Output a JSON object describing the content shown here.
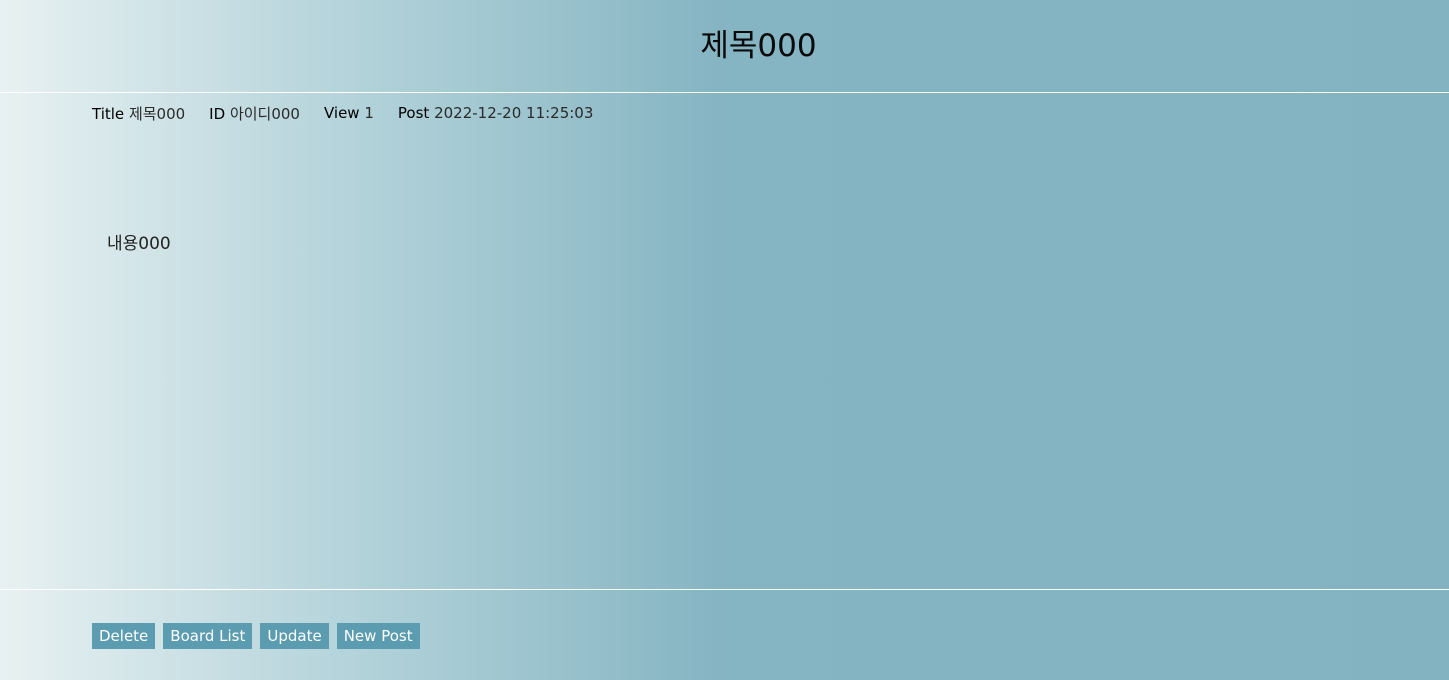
{
  "post": {
    "title": "제목000",
    "content": "내용000"
  },
  "meta": {
    "title_label": "Title",
    "title_value": "제목000",
    "id_label": "ID",
    "id_value": "아이디000",
    "view_label": "View",
    "view_value": "1",
    "post_label": "Post",
    "post_value": "2022-12-20 11:25:03"
  },
  "actions": {
    "delete": "Delete",
    "board_list": "Board List",
    "update": "Update",
    "new_post": "New Post"
  },
  "colors": {
    "button_bg": "#5b9cb0",
    "button_text": "#ffffff",
    "gradient_start": "#e8f1f2",
    "gradient_end": "#83b3c1"
  }
}
